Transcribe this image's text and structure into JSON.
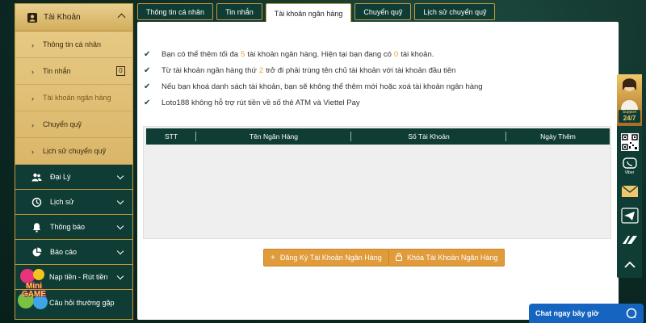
{
  "sidebar": {
    "account": "Tài Khoản",
    "sub_items": [
      {
        "label": "Thông tin cá nhân"
      },
      {
        "label": "Tin nhắn",
        "badge": "0"
      },
      {
        "label": "Tài khoản ngân hàng"
      },
      {
        "label": "Chuyển quỹ"
      },
      {
        "label": "Lịch sử chuyển quỹ"
      }
    ],
    "items": [
      {
        "label": "Đại Lý"
      },
      {
        "label": "Lịch sử"
      },
      {
        "label": "Thông báo"
      },
      {
        "label": "Báo cáo"
      },
      {
        "label": "Nạp tiền - Rút tiền"
      },
      {
        "label": "Câu hỏi thường gặp"
      }
    ]
  },
  "tabs": [
    {
      "label": "Thông tin cá nhân"
    },
    {
      "label": "Tin nhắn"
    },
    {
      "label": "Tài khoản ngân hàng"
    },
    {
      "label": "Chuyển quỹ"
    },
    {
      "label": "Lịch sử chuyển quỹ"
    }
  ],
  "rules": {
    "r1_a": "Bạn có thể thêm tối đa",
    "r1_max": "5",
    "r1_b": "tài khoản ngân hàng. Hiện tại bạn đang có",
    "r1_count": "0",
    "r1_c": "tài khoản.",
    "r2_a": "Từ tài khoản ngân hàng thứ",
    "r2_num": "2",
    "r2_b": "trở đi phải trùng tên chủ tài khoản với tài khoản đầu tiên",
    "r3": "Nếu bạn khoá danh sách tài khoản, bạn sẽ không thể thêm mới hoặc xoá tài khoản ngân hàng",
    "r4": "Loto188 không hỗ trợ rút tiền về số thẻ ATM và Viettel Pay"
  },
  "table": {
    "columns": [
      "STT",
      "Tên Ngân Hàng",
      "Số Tài Khoản",
      "Ngày Thêm"
    ]
  },
  "buttons": {
    "register": "Đăng Ký Tài Khoản Ngân Hàng",
    "lock": "Khóa Tài Khoản Ngân Hàng"
  },
  "rightbar": {
    "support": "Support",
    "hours": "24/7",
    "viber": "Viber"
  },
  "mini_game": {
    "line1": "Mini",
    "line2": "GAME"
  },
  "chat": {
    "label": "Chat ngay bây giờ"
  },
  "colors": {
    "primary": "#0f3d35",
    "gold": "#c49a3a",
    "accent": "#e09b3a",
    "chat": "#1565c0"
  }
}
